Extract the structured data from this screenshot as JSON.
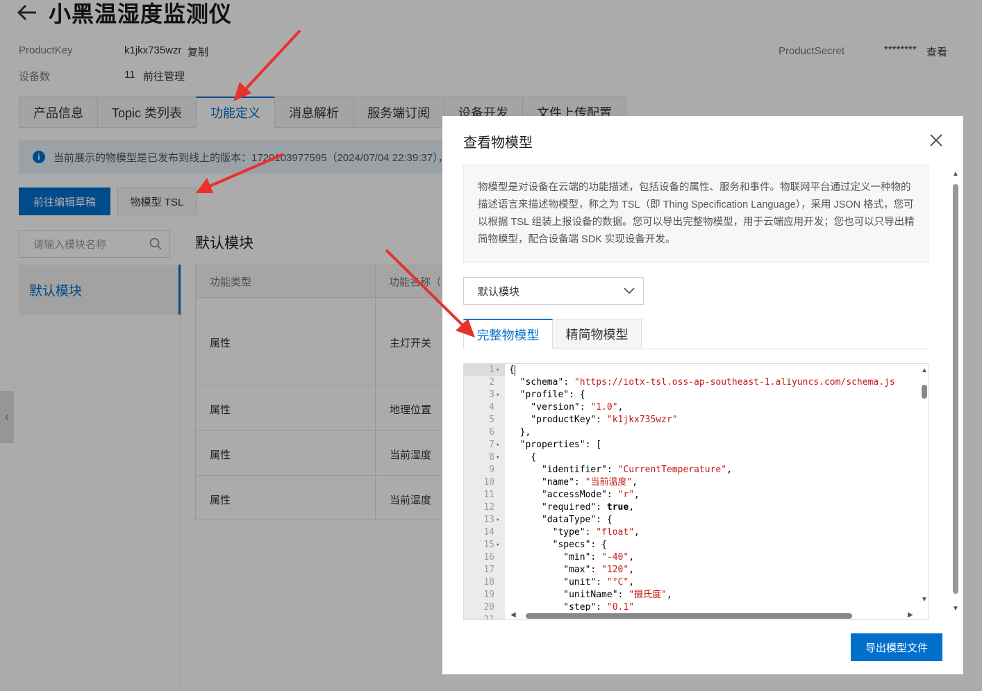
{
  "header": {
    "title": "小黑温湿度监测仪",
    "product_key_label": "ProductKey",
    "product_key_value": "k1jkx735wzr",
    "copy_link": "复制",
    "device_count_label": "设备数",
    "device_count_value": "11",
    "manage_link": "前往管理",
    "product_secret_label": "ProductSecret",
    "product_secret_value": "********",
    "view_link": "查看"
  },
  "tabs": [
    "产品信息",
    "Topic 类列表",
    "功能定义",
    "消息解析",
    "服务端订阅",
    "设备开发",
    "文件上传配置"
  ],
  "active_tab": "功能定义",
  "notice": "当前展示的物模型是已发布到线上的版本：1720103977595（2024/07/04 22:39:37），",
  "buttons": {
    "edit_draft": "前往编辑草稿",
    "tsl": "物模型 TSL"
  },
  "module_search": {
    "placeholder": "请输入模块名称"
  },
  "modules": [
    "默认模块"
  ],
  "section_title": "默认模块",
  "table": {
    "headers": [
      "功能类型",
      "功能名称（"
    ],
    "rows": [
      {
        "type": "属性",
        "name": "主灯开关"
      },
      {
        "type": "属性",
        "name": "地理位置"
      },
      {
        "type": "属性",
        "name": "当前湿度"
      },
      {
        "type": "属性",
        "name": "当前温度"
      }
    ]
  },
  "modal": {
    "title": "查看物模型",
    "description": "物模型是对设备在云端的功能描述，包括设备的属性、服务和事件。物联网平台通过定义一种物的描述语言来描述物模型，称之为 TSL（即 Thing Specification Language），采用 JSON 格式，您可以根据 TSL 组装上报设备的数据。您可以导出完整物模型，用于云端应用开发；您也可以只导出精简物模型，配合设备端 SDK 实现设备开发。",
    "module_select": "默认模块",
    "tabs": [
      "完整物模型",
      "精简物模型"
    ],
    "active_tab": "完整物模型",
    "export_button": "导出模型文件",
    "code_lines": [
      {
        "n": "1",
        "fold": true,
        "html": "{"
      },
      {
        "n": "2",
        "fold": false,
        "html": "  \"schema\": <span class=\"s\">\"https://iotx-tsl.oss-ap-southeast-1.aliyuncs.com/schema.js</span>"
      },
      {
        "n": "3",
        "fold": true,
        "html": "  \"profile\": {"
      },
      {
        "n": "4",
        "fold": false,
        "html": "    \"version\": <span class=\"s\">\"1.0\"</span>,"
      },
      {
        "n": "5",
        "fold": false,
        "html": "    \"productKey\": <span class=\"s\">\"k1jkx735wzr\"</span>"
      },
      {
        "n": "6",
        "fold": false,
        "html": "  },"
      },
      {
        "n": "7",
        "fold": true,
        "html": "  \"properties\": ["
      },
      {
        "n": "8",
        "fold": true,
        "html": "    {"
      },
      {
        "n": "9",
        "fold": false,
        "html": "      \"identifier\": <span class=\"s\">\"CurrentTemperature\"</span>,"
      },
      {
        "n": "10",
        "fold": false,
        "html": "      \"name\": <span class=\"s\">\"当前温度\"</span>,"
      },
      {
        "n": "11",
        "fold": false,
        "html": "      \"accessMode\": <span class=\"s\">\"r\"</span>,"
      },
      {
        "n": "12",
        "fold": false,
        "html": "      \"required\": <span class=\"kw\">true</span>,"
      },
      {
        "n": "13",
        "fold": true,
        "html": "      \"dataType\": {"
      },
      {
        "n": "14",
        "fold": false,
        "html": "        \"type\": <span class=\"s\">\"float\"</span>,"
      },
      {
        "n": "15",
        "fold": true,
        "html": "        \"specs\": {"
      },
      {
        "n": "16",
        "fold": false,
        "html": "          \"min\": <span class=\"s\">\"-40\"</span>,"
      },
      {
        "n": "17",
        "fold": false,
        "html": "          \"max\": <span class=\"s\">\"120\"</span>,"
      },
      {
        "n": "18",
        "fold": false,
        "html": "          \"unit\": <span class=\"s\">\"°C\"</span>,"
      },
      {
        "n": "19",
        "fold": false,
        "html": "          \"unitName\": <span class=\"s\">\"摄氏度\"</span>,"
      },
      {
        "n": "20",
        "fold": false,
        "html": "          \"step\": <span class=\"s\">\"0.1\"</span>"
      },
      {
        "n": "21",
        "fold": false,
        "html": ""
      }
    ]
  },
  "colors": {
    "primary": "#0070cc",
    "string": "#c41a16",
    "annotation_arrow": "#e8312b"
  }
}
